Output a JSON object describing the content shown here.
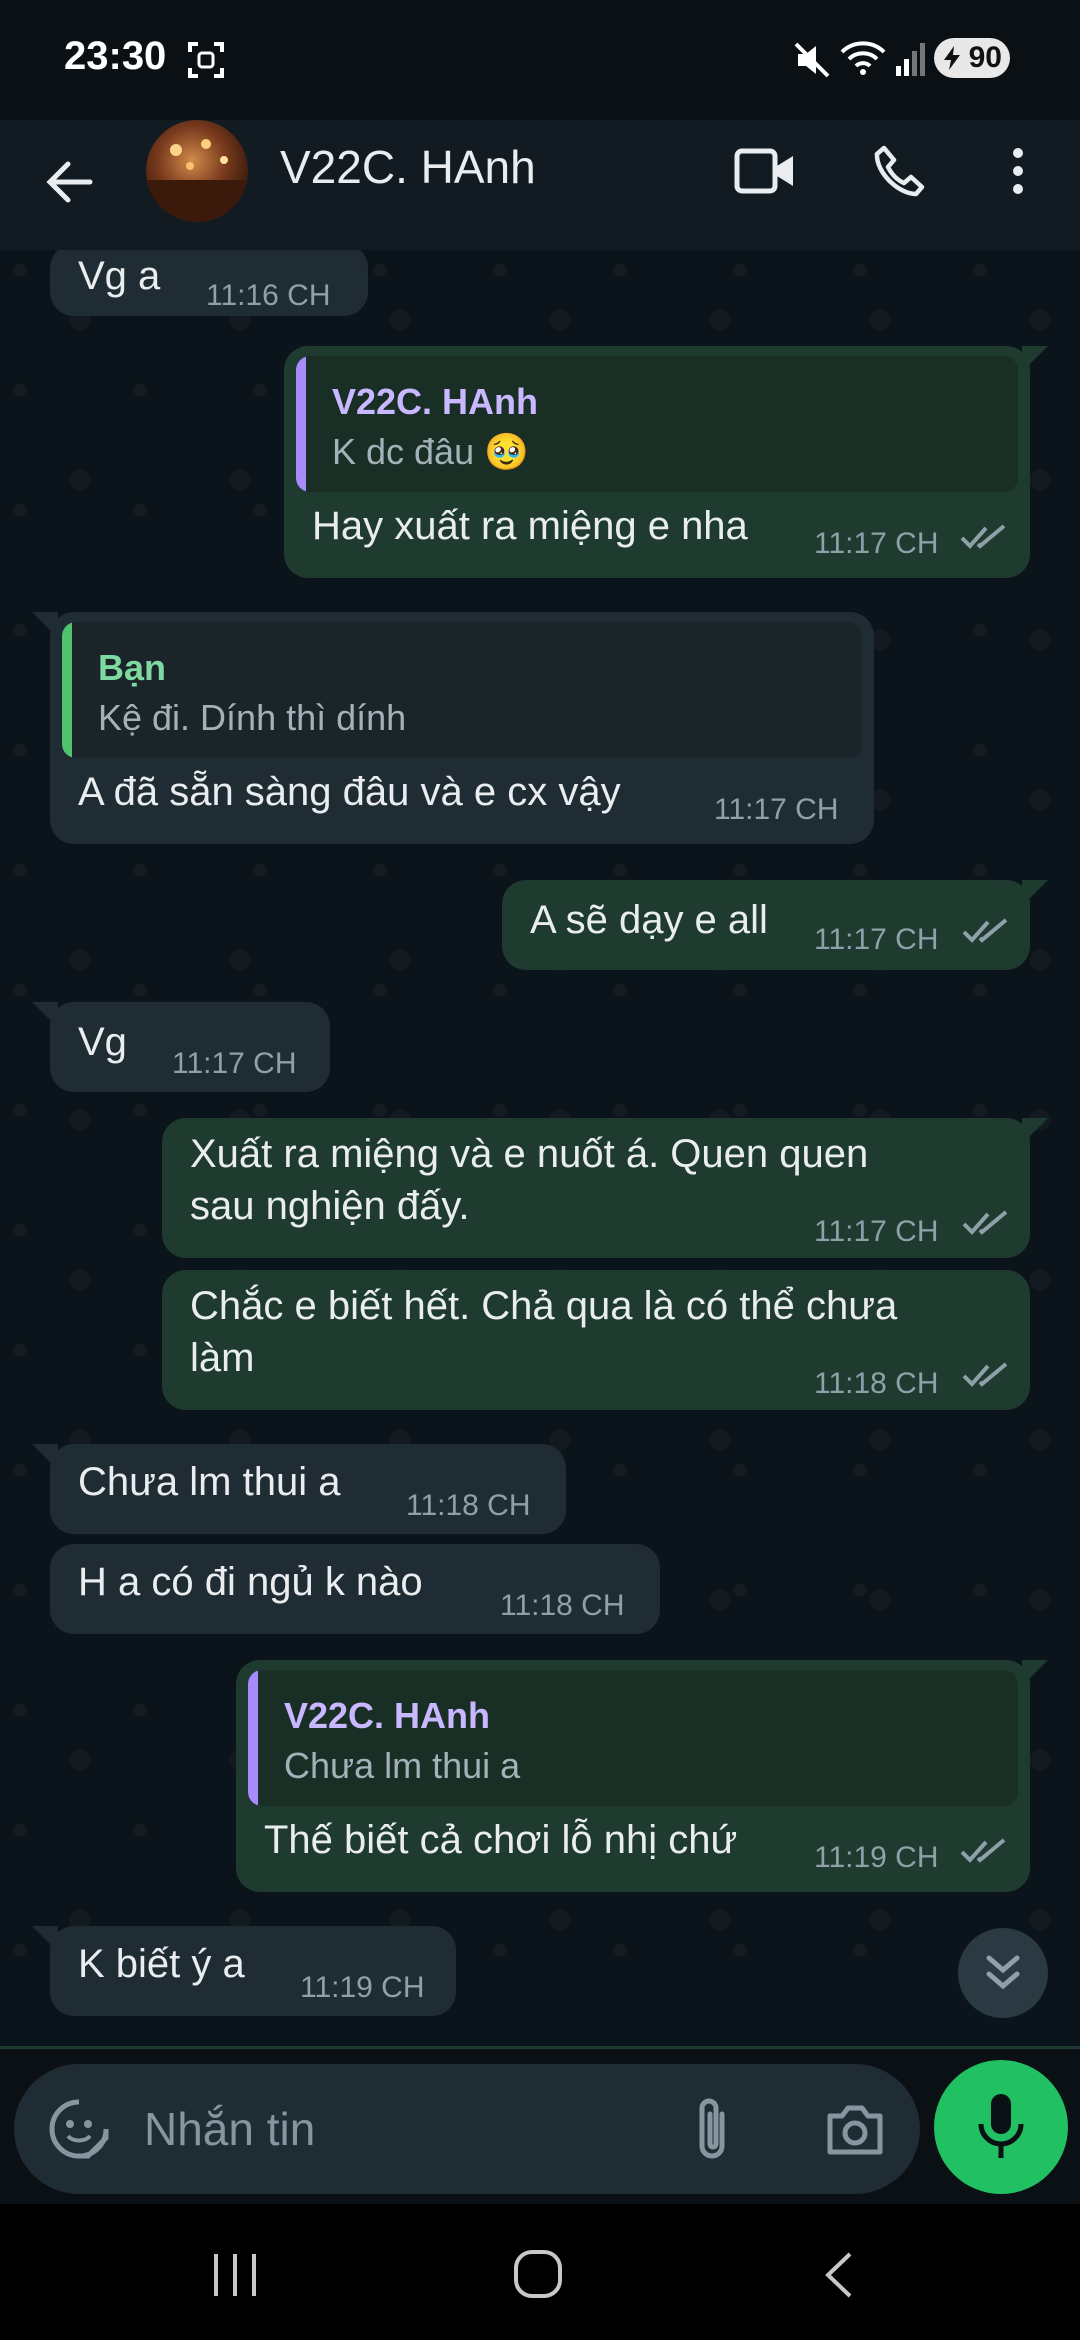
{
  "status_bar": {
    "time": "23:30",
    "battery": "90"
  },
  "header": {
    "contact_name": "V22C. HAnh"
  },
  "messages": [
    {
      "dir": "in",
      "text": "Vg a",
      "time": "11:16 CH"
    },
    {
      "dir": "out",
      "quote": {
        "author": "V22C. HAnh",
        "text": "K dc đâu 🥹"
      },
      "text": "Hay xuất ra miệng e nha",
      "time": "11:17 CH"
    },
    {
      "dir": "in",
      "quote": {
        "author": "Bạn",
        "text": "Kệ đi. Dính thì dính"
      },
      "text": "A đã sẵn sàng đâu và e cx vậy",
      "time": "11:17 CH"
    },
    {
      "dir": "out",
      "text": "A sẽ dạy e all",
      "time": "11:17 CH"
    },
    {
      "dir": "in",
      "text": "Vg",
      "time": "11:17 CH"
    },
    {
      "dir": "out",
      "text_line1": "Xuất ra miệng và e nuốt á. Quen quen",
      "text_line2": "sau nghiện đấy.",
      "time": "11:17 CH"
    },
    {
      "dir": "out",
      "text_line1": "Chắc e biết hết. Chả qua là có thể chưa",
      "text_line2": "làm",
      "time": "11:18 CH"
    },
    {
      "dir": "in",
      "text": "Chưa lm thui a",
      "time": "11:18 CH"
    },
    {
      "dir": "in",
      "text": "H a có đi ngủ k nào",
      "time": "11:18 CH"
    },
    {
      "dir": "out",
      "quote": {
        "author": "V22C. HAnh",
        "text": "Chưa lm thui a"
      },
      "text": "Thế biết cả chơi lỗ nhị chứ",
      "time": "11:19 CH"
    },
    {
      "dir": "in",
      "text": "K biết ý a",
      "time": "11:19 CH"
    }
  ],
  "composer": {
    "placeholder": "Nhắn tin"
  },
  "colors": {
    "accent": "#21c063",
    "incoming_bubble": "#202c33",
    "outgoing_bubble": "#1f3a2f",
    "quote_bar_contact": "#a78bfa",
    "quote_bar_self": "#4fc36e"
  },
  "icons": {
    "back": "arrow-left-icon",
    "video": "video-camera-icon",
    "call": "phone-icon",
    "menu": "more-vert-icon",
    "emoji": "sticker-icon",
    "attach": "paperclip-icon",
    "camera": "camera-icon",
    "mic": "microphone-icon",
    "scroll": "double-chevron-down-icon"
  }
}
